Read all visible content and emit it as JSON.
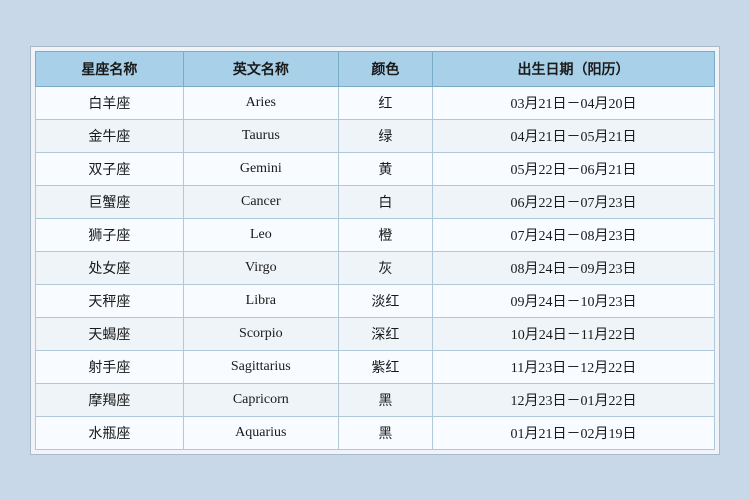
{
  "table": {
    "headers": [
      "星座名称",
      "英文名称",
      "颜色",
      "出生日期（阳历）"
    ],
    "rows": [
      {
        "zh": "白羊座",
        "en": "Aries",
        "color": "红",
        "dates": "03月21日－04月20日"
      },
      {
        "zh": "金牛座",
        "en": "Taurus",
        "color": "绿",
        "dates": "04月21日－05月21日"
      },
      {
        "zh": "双子座",
        "en": "Gemini",
        "color": "黄",
        "dates": "05月22日－06月21日"
      },
      {
        "zh": "巨蟹座",
        "en": "Cancer",
        "color": "白",
        "dates": "06月22日－07月23日"
      },
      {
        "zh": "狮子座",
        "en": "Leo",
        "color": "橙",
        "dates": "07月24日－08月23日"
      },
      {
        "zh": "处女座",
        "en": "Virgo",
        "color": "灰",
        "dates": "08月24日－09月23日"
      },
      {
        "zh": "天秤座",
        "en": "Libra",
        "color": "淡红",
        "dates": "09月24日－10月23日"
      },
      {
        "zh": "天蝎座",
        "en": "Scorpio",
        "color": "深红",
        "dates": "10月24日－11月22日"
      },
      {
        "zh": "射手座",
        "en": "Sagittarius",
        "color": "紫红",
        "dates": "11月23日－12月22日"
      },
      {
        "zh": "摩羯座",
        "en": "Capricorn",
        "color": "黑",
        "dates": "12月23日－01月22日"
      },
      {
        "zh": "水瓶座",
        "en": "Aquarius",
        "color": "黑",
        "dates": "01月21日－02月19日"
      }
    ]
  }
}
